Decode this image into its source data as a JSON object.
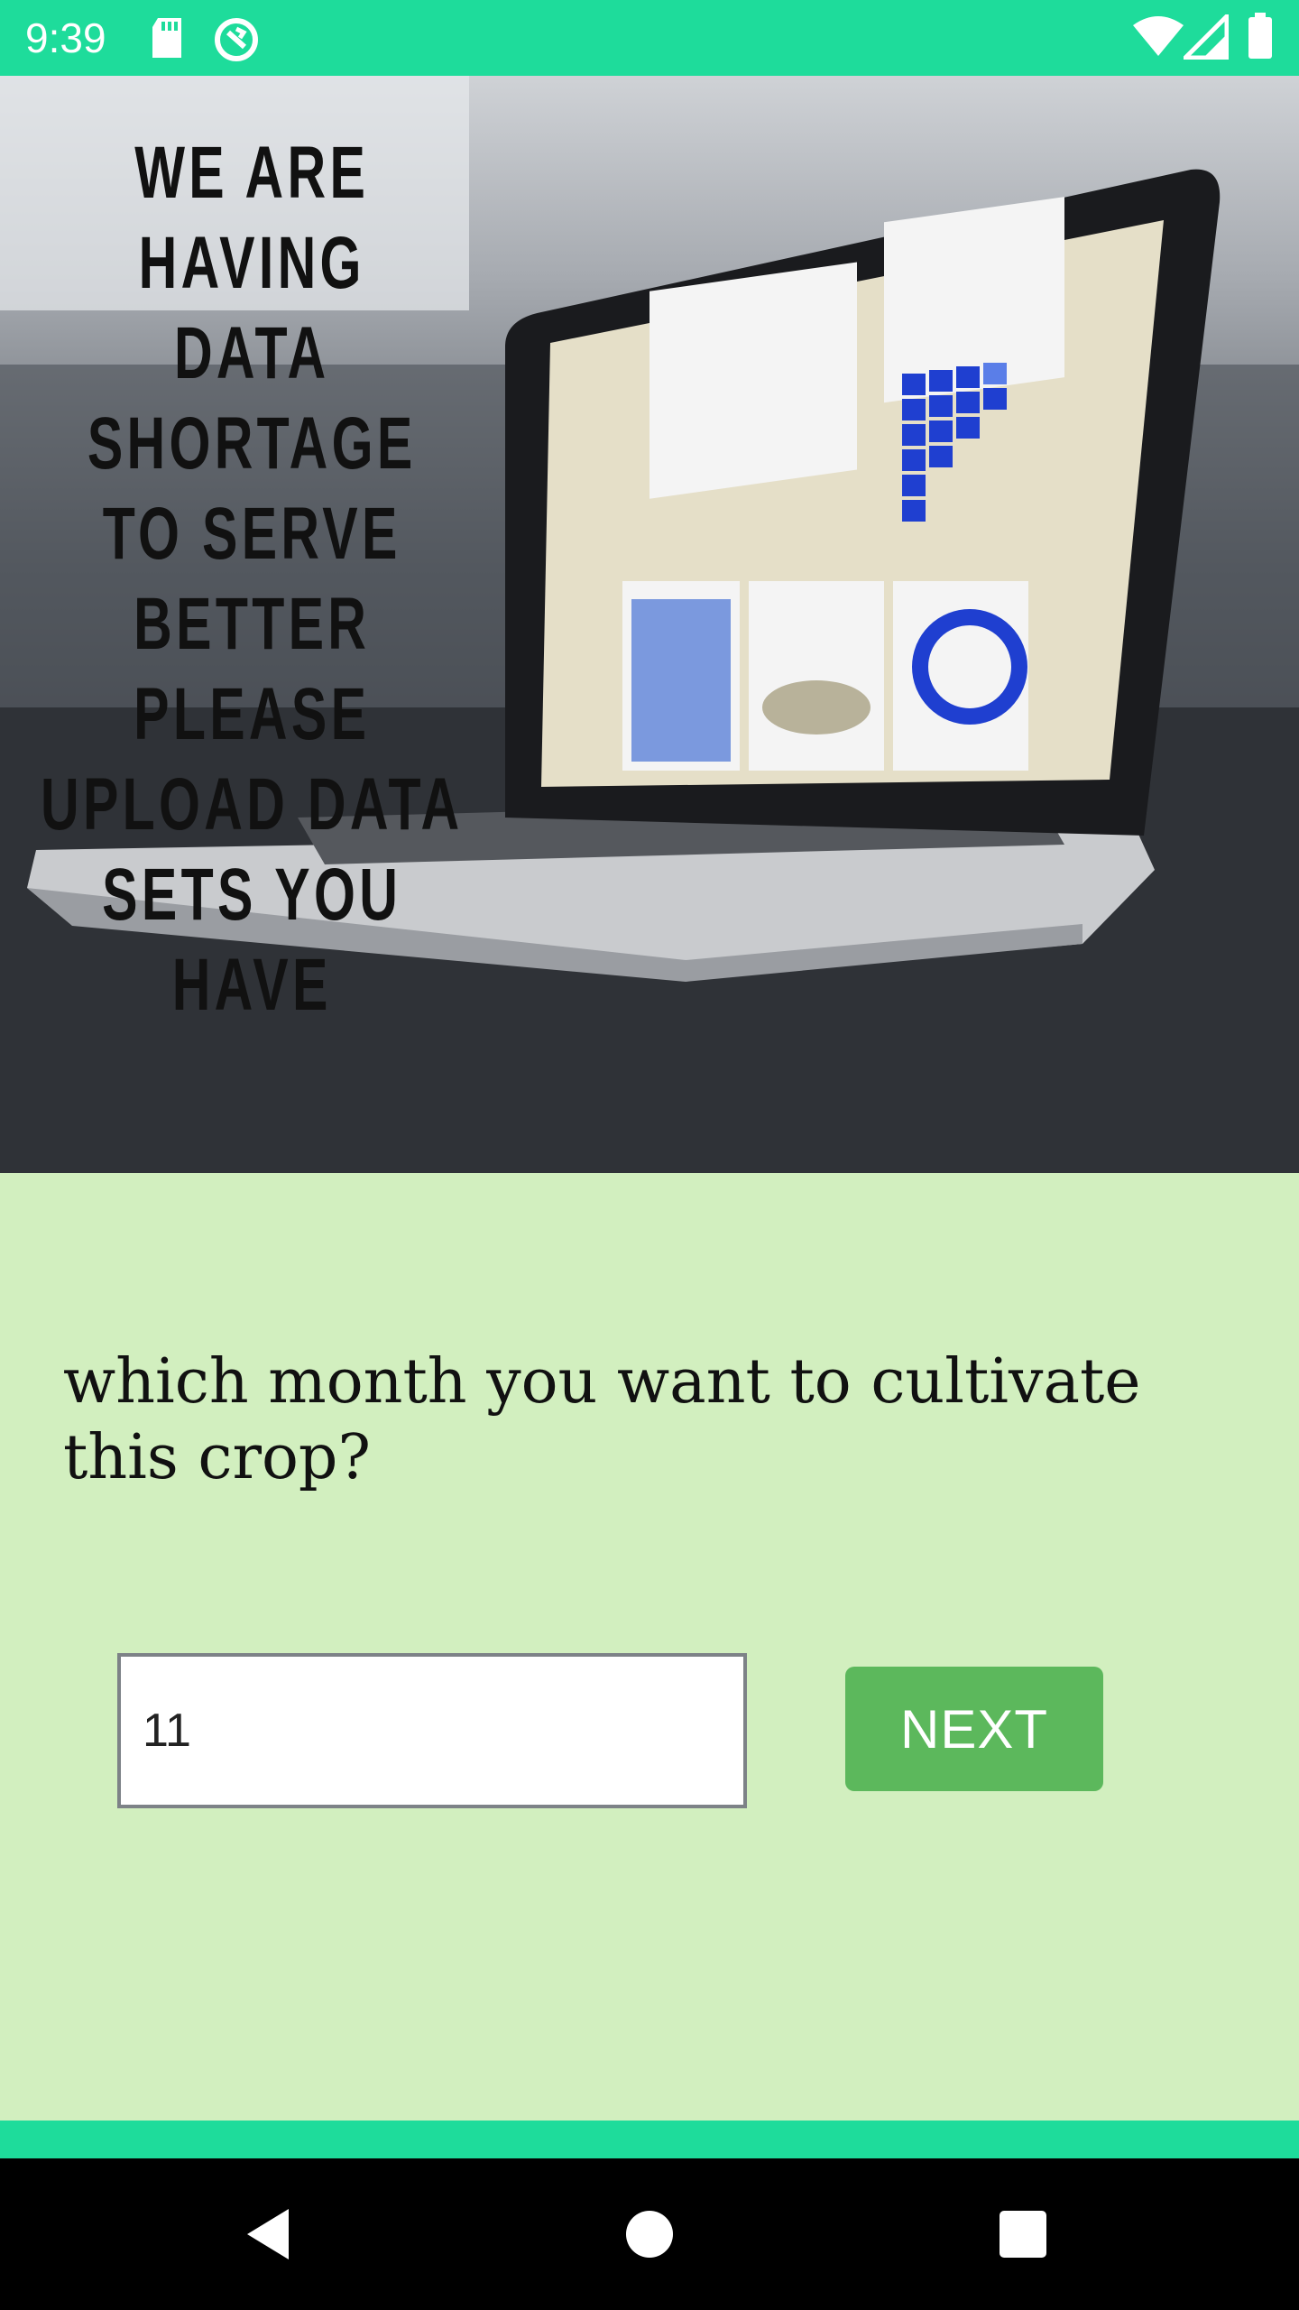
{
  "status_bar": {
    "time": "9:39",
    "icons": [
      "sd-card-icon",
      "sync-icon",
      "wifi-icon",
      "signal-icon",
      "battery-icon"
    ]
  },
  "hero": {
    "overlay_text": "WE ARE HAVING DATA SHORTAGE TO SERVE BETTER PLEASE UPLOAD DATA SETS YOU HAVE",
    "lines": [
      "WE ARE HAVING",
      "DATA SHORTAGE",
      "TO SERVE",
      "BETTER PLEASE",
      "UPLOAD DATA",
      "SETS YOU HAVE"
    ]
  },
  "form": {
    "question": "which month you want to cultivate this crop?",
    "month_value": "11",
    "next_label": "NEXT"
  },
  "nav_bar": {
    "buttons": [
      "back-icon",
      "home-icon",
      "recents-icon"
    ]
  },
  "colors": {
    "status_bar": "#1edc9b",
    "background": "#d2efbf",
    "next_button": "#5cb85c"
  }
}
